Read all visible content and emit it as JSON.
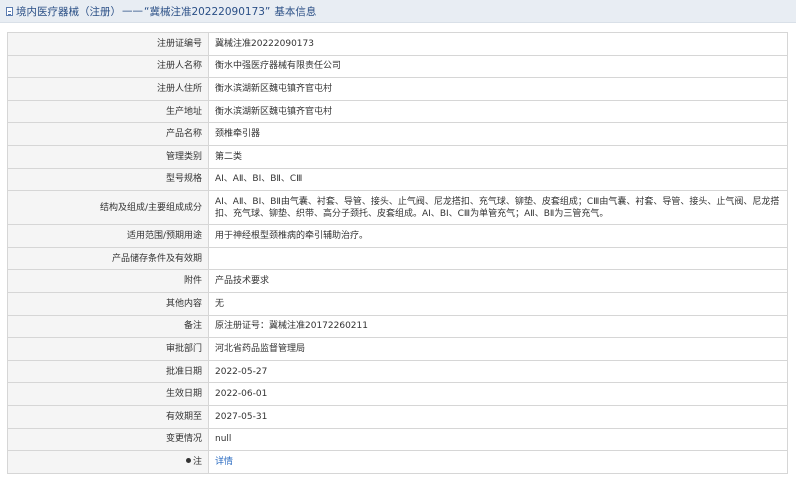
{
  "header": {
    "title_prefix": "境内医疗器械（注册）",
    "dash": "——",
    "cert_quoted": "“冀械注准20222090173”",
    "title_suffix": "基本信息"
  },
  "rows": [
    {
      "label": "注册证编号",
      "value": "冀械注准20222090173"
    },
    {
      "label": "注册人名称",
      "value": "衡水中强医疗器械有限责任公司"
    },
    {
      "label": "注册人住所",
      "value": "衡水滨湖新区魏屯镇齐官屯村"
    },
    {
      "label": "生产地址",
      "value": "衡水滨湖新区魏屯镇齐官屯村"
    },
    {
      "label": "产品名称",
      "value": "颈椎牵引器"
    },
    {
      "label": "管理类别",
      "value": "第二类"
    },
    {
      "label": "型号规格",
      "value": "AⅠ、AⅡ、BⅠ、BⅡ、CⅢ"
    },
    {
      "label": "结构及组成/主要组成成分",
      "value": "AⅠ、AⅡ、BⅠ、BⅡ由气囊、衬套、导管、接头、止气阀、尼龙搭扣、充气球、铆垫、皮套组成；CⅢ由气囊、衬套、导管、接头、止气阀、尼龙搭扣、充气球、铆垫、织带、高分子颈托、皮套组成。AⅠ、BⅠ、CⅢ为单管充气；AⅡ、BⅡ为三管充气。"
    },
    {
      "label": "适用范围/预期用途",
      "value": "用于神经根型颈椎病的牵引辅助治疗。"
    },
    {
      "label": "产品储存条件及有效期",
      "value": ""
    },
    {
      "label": "附件",
      "value": "产品技术要求"
    },
    {
      "label": "其他内容",
      "value": "无"
    },
    {
      "label": "备注",
      "value": "原注册证号：冀械注准20172260211"
    },
    {
      "label": "审批部门",
      "value": "河北省药品监督管理局"
    },
    {
      "label": "批准日期",
      "value": "2022-05-27"
    },
    {
      "label": "生效日期",
      "value": "2022-06-01"
    },
    {
      "label": "有效期至",
      "value": "2027-05-31"
    },
    {
      "label": "变更情况",
      "value": "null"
    },
    {
      "label": "注",
      "value": "详情"
    }
  ],
  "icons": {
    "header": "document-icon",
    "note": "pin-icon"
  },
  "colors": {
    "header_bg": "#e8edf3",
    "header_text": "#2a4f86",
    "label_bg": "#f5f5f5",
    "link": "#2a6bc1",
    "border": "#d6d6d6"
  }
}
